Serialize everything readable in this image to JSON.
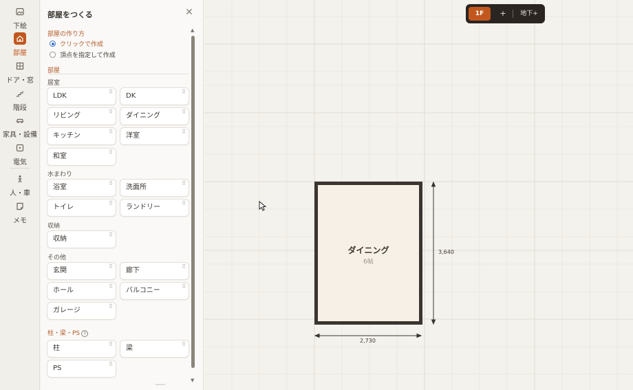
{
  "rail": {
    "items": [
      {
        "label": "下絵",
        "icon": "image-icon"
      },
      {
        "label": "部屋",
        "icon": "house-icon",
        "active": true
      },
      {
        "label": "ドア・窓",
        "icon": "window-icon"
      },
      {
        "label": "階段",
        "icon": "stairs-icon"
      },
      {
        "label": "家具・設備",
        "icon": "car-icon"
      },
      {
        "label": "電気",
        "icon": "outlet-icon"
      },
      {
        "label": "人・車",
        "icon": "person-icon"
      },
      {
        "label": "メモ",
        "icon": "note-icon"
      }
    ]
  },
  "panel": {
    "title": "部屋をつくる",
    "method_label": "部屋の作り方",
    "method_options": [
      "クリックで作成",
      "頂点を指定して作成"
    ],
    "method_selected": "クリックで作成",
    "rooms_label": "部屋",
    "groups": [
      {
        "label": "居室",
        "items": [
          "LDK",
          "DK",
          "リビング",
          "ダイニング",
          "キッチン",
          "洋室",
          "和室"
        ]
      },
      {
        "label": "水まわり",
        "items": [
          "浴室",
          "洗面所",
          "トイレ",
          "ランドリー"
        ]
      },
      {
        "label": "収納",
        "items": [
          "収納"
        ]
      },
      {
        "label": "その他",
        "items": [
          "玄関",
          "廊下",
          "ホール",
          "バルコニー",
          "ガレージ"
        ]
      },
      {
        "label": "柱・梁・PS",
        "items": [
          "柱",
          "梁",
          "PS"
        ]
      }
    ]
  },
  "floor_switch": {
    "current": "1F",
    "add": "+",
    "basement": "地下+"
  },
  "room": {
    "name": "ダイニング",
    "size": "6帖",
    "width_label": "2,730",
    "height_label": "3,640"
  },
  "colors": {
    "accent": "#c2571e",
    "wall": "#3a3530",
    "room_fill": "#f7f0e6",
    "canvas": "#f4f2ec"
  }
}
